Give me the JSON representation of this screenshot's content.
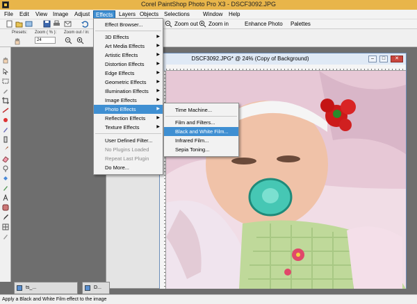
{
  "window": {
    "title": "Corel PaintShop Photo Pro X3 - DSCF3092.JPG"
  },
  "menubar": [
    "File",
    "Edit",
    "View",
    "Image",
    "Adjust",
    "Effects",
    "Layers",
    "Objects",
    "Selections",
    "Window",
    "Help"
  ],
  "toolbar": {
    "zoom_out": "Zoom out",
    "zoom_in": "Zoom in",
    "enhance": "Enhance Photo",
    "palettes": "Palettes"
  },
  "options": {
    "presets_label": "Presets:",
    "zoom_label": "Zoom ( % ):",
    "zoom_value": "24",
    "zoom_out_in_label": "Zoom out / in:"
  },
  "effects_menu": [
    "Effect Browser...",
    "3D Effects",
    "Art Media Effects",
    "Artistic Effects",
    "Distortion Effects",
    "Edge Effects",
    "Geometric Effects",
    "Illumination Effects",
    "Image Effects",
    "Photo Effects",
    "Reflection Effects",
    "Texture Effects",
    "User Defined Filter...",
    "No Plugins Loaded",
    "Repeat Last Plugin",
    "Do More..."
  ],
  "photo_submenu": [
    "Time Machine...",
    "Film and Filters...",
    "Black and White Film...",
    "Infrared Film...",
    "Sepia Toning..."
  ],
  "document": {
    "title": "DSCF3092.JPG* @  24% (Copy of Background)"
  },
  "minimized": [
    "ts_...",
    "D..."
  ],
  "status": "Apply a Black and White Film effect to the image",
  "colors": {
    "highlight": "#3f8fd2",
    "titlebar": "#e8b54a"
  }
}
